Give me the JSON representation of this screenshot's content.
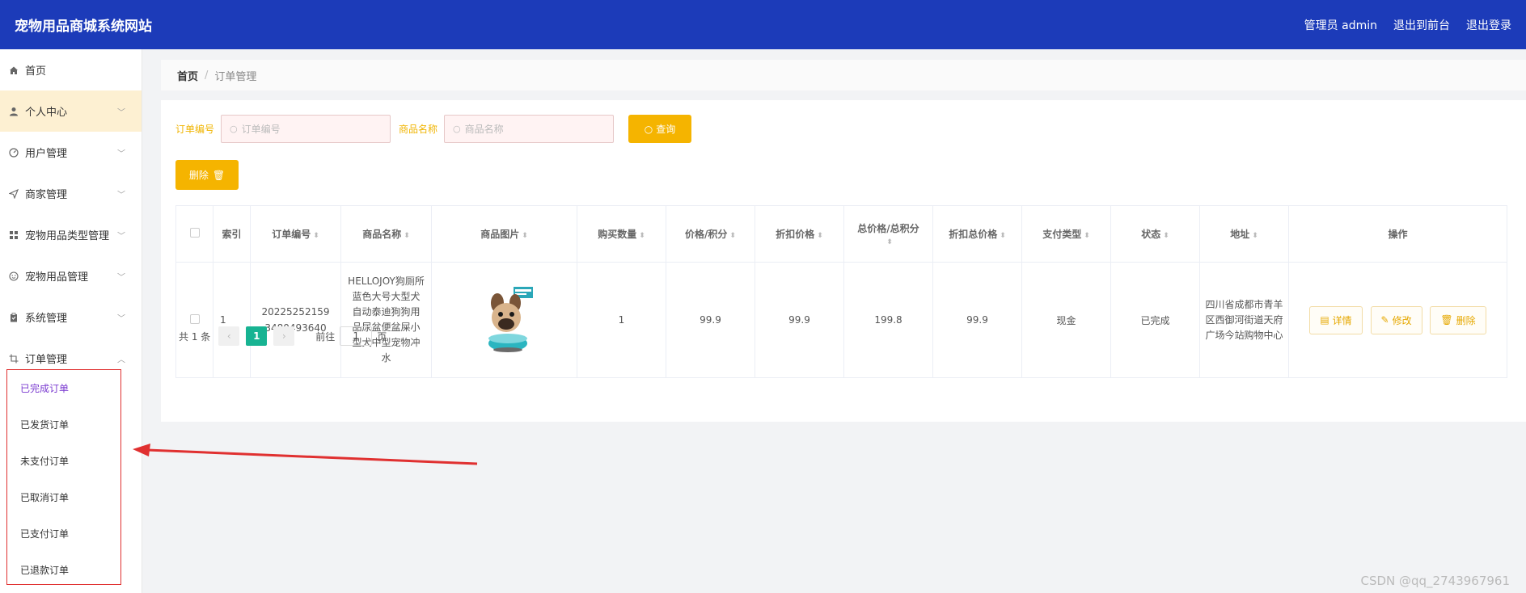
{
  "header": {
    "title": "宠物用品商城系统网站",
    "links": [
      "管理员 admin",
      "退出到前台",
      "退出登录"
    ]
  },
  "sidebar": {
    "items": [
      {
        "label": "首页",
        "icon": "home-icon"
      },
      {
        "label": "个人中心",
        "icon": "user-icon"
      },
      {
        "label": "用户管理",
        "icon": "gauge-icon"
      },
      {
        "label": "商家管理",
        "icon": "send-icon"
      },
      {
        "label": "宠物用品类型管理",
        "icon": "grid-icon"
      },
      {
        "label": "宠物用品管理",
        "icon": "smile-icon"
      },
      {
        "label": "系统管理",
        "icon": "clipboard-icon"
      },
      {
        "label": "订单管理",
        "icon": "crop-icon"
      }
    ],
    "submenu": [
      "已完成订单",
      "已发货订单",
      "未支付订单",
      "已取消订单",
      "已支付订单",
      "已退款订单"
    ]
  },
  "breadcrumb": {
    "home": "首页",
    "separator": "/",
    "current": "订单管理"
  },
  "search": {
    "order_label": "订单编号",
    "order_placeholder": "订单编号",
    "goods_label": "商品名称",
    "goods_placeholder": "商品名称",
    "query_label": "查询"
  },
  "delete_button": "删除",
  "table": {
    "headers": [
      "索引",
      "订单编号",
      "商品名称",
      "商品图片",
      "购买数量",
      "价格/积分",
      "折扣价格",
      "总价格/总积分",
      "折扣总价格",
      "支付类型",
      "状态",
      "地址",
      "操作"
    ],
    "rows": [
      {
        "index": "1",
        "order_no": "202252521593480493640",
        "goods_name": "HELLOJOY狗厕所蓝色大号大型犬自动泰迪狗狗用品尿盆便盆屎小型犬中型宠物冲水",
        "quantity": "1",
        "price": "99.9",
        "discount_price": "99.9",
        "total": "199.8",
        "discount_total": "99.9",
        "pay_type": "现金",
        "status": "已完成",
        "address": "四川省成都市青羊区西御河街道天府广场今站购物中心",
        "actions": [
          "详情",
          "修改",
          "删除"
        ]
      }
    ]
  },
  "pagination": {
    "total_text": "共 1 条",
    "current_page": "1",
    "goto_prefix": "前往",
    "goto_value": "1",
    "goto_suffix": "页"
  },
  "watermark": "CSDN @qq_2743967961",
  "colors": {
    "header": "#1c3bb9",
    "accent": "#f5b400",
    "page_active": "#17b392",
    "annotation": "#e03030"
  }
}
